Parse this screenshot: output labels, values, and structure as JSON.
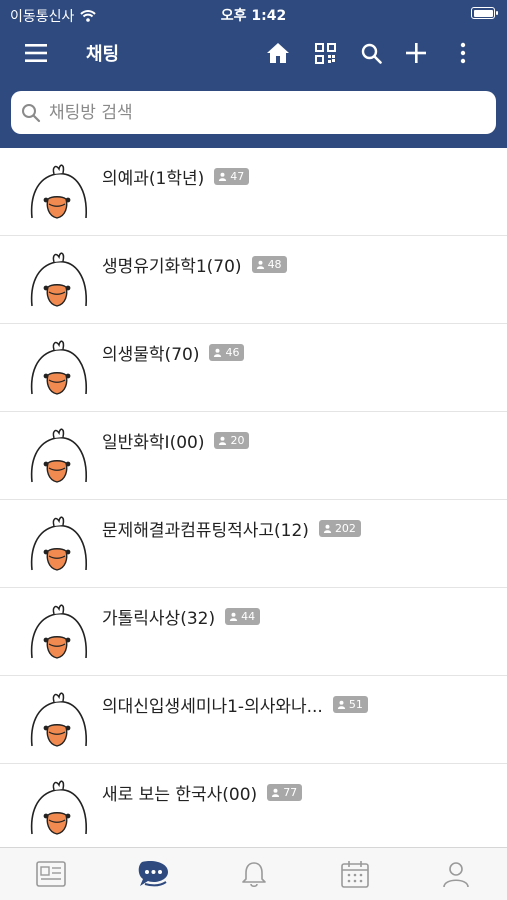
{
  "status_bar": {
    "carrier": "이동통신사",
    "time": "오후 1:42"
  },
  "nav": {
    "title": "채팅",
    "icons": [
      "menu-icon",
      "home-icon",
      "qr-code-icon",
      "search-icon",
      "plus-icon",
      "more-icon"
    ]
  },
  "search": {
    "placeholder": "채팅방 검색",
    "value": ""
  },
  "rooms": [
    {
      "name": "의예과(1학년)",
      "members": "47"
    },
    {
      "name": "생명유기화학1(70)",
      "members": "48"
    },
    {
      "name": "의생물학(70)",
      "members": "46"
    },
    {
      "name": "일반화학I(00)",
      "members": "20"
    },
    {
      "name": "문제해결과컴퓨팅적사고(12)",
      "members": "202"
    },
    {
      "name": "가톨릭사상(32)",
      "members": "44"
    },
    {
      "name": "의대신입생세미나1-의사와나...",
      "members": "51"
    },
    {
      "name": "새로 보는 한국사(00)",
      "members": "77"
    }
  ],
  "tab_bar": {
    "icons": [
      "news-icon",
      "chat-icon",
      "bell-icon",
      "calendar-icon",
      "profile-icon"
    ],
    "active": "chat-icon"
  },
  "colors": {
    "header": "#2e4a7f",
    "badge": "#a8a8a8",
    "tab_active": "#2e4a7f",
    "tab_inactive": "#9a9a9a",
    "avatar_beak": "#f08a50"
  }
}
